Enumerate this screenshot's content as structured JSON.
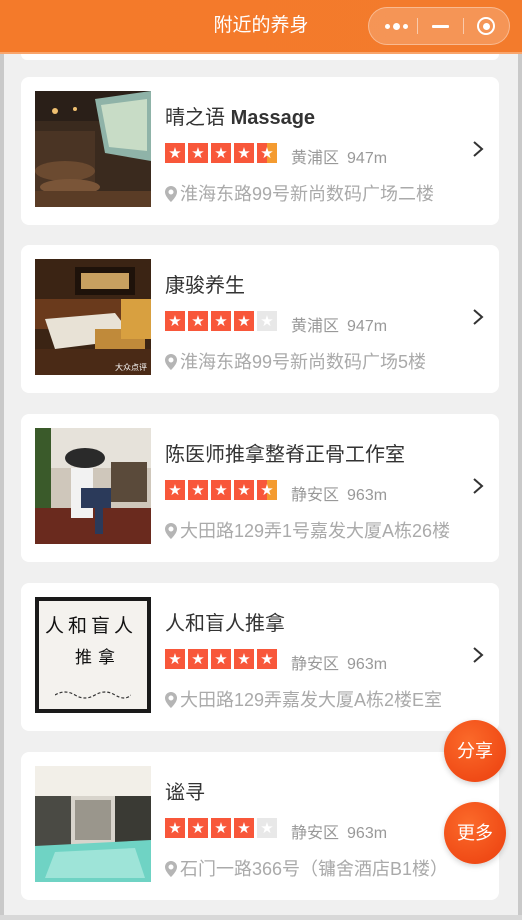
{
  "nav": {
    "title": "附近的养身",
    "more_icon": "more-dots-icon",
    "minimize_icon": "minimize-icon",
    "close_icon": "target-close-icon"
  },
  "colors": {
    "brand": "#f47a2a",
    "star": "#f8573a",
    "star_half": "#f49b30",
    "fab": "#f04b16"
  },
  "shops": [
    {
      "name": "晴之语",
      "name_en": "Massage",
      "rating": 4.5,
      "district": "黄浦区",
      "distance": "947m",
      "address": "淮海东路99号新尚数码广场二楼"
    },
    {
      "name": "康骏养生",
      "name_en": "",
      "rating": 4,
      "district": "黄浦区",
      "distance": "947m",
      "address": "淮海东路99号新尚数码广场5楼"
    },
    {
      "name": "陈医师推拿整脊正骨工作室",
      "name_en": "",
      "rating": 4.5,
      "district": "静安区",
      "distance": "963m",
      "address": "大田路129弄1号嘉发大厦A栋26楼"
    },
    {
      "name": "人和盲人推拿",
      "name_en": "",
      "rating": 5,
      "district": "静安区",
      "distance": "963m",
      "address": "大田路129弄嘉发大厦A栋2楼E室"
    },
    {
      "name": "谧寻",
      "name_en": "",
      "rating": 4,
      "district": "静安区",
      "distance": "963m",
      "address": "石门一路366号（镛舍酒店B1楼）"
    }
  ],
  "thumb_signs": {
    "shop4_line1": "人和盲人",
    "shop4_line2": "推拿",
    "shop2_watermark": "大众点评"
  },
  "fab": {
    "share_label": "分享",
    "more_label": "更多"
  }
}
